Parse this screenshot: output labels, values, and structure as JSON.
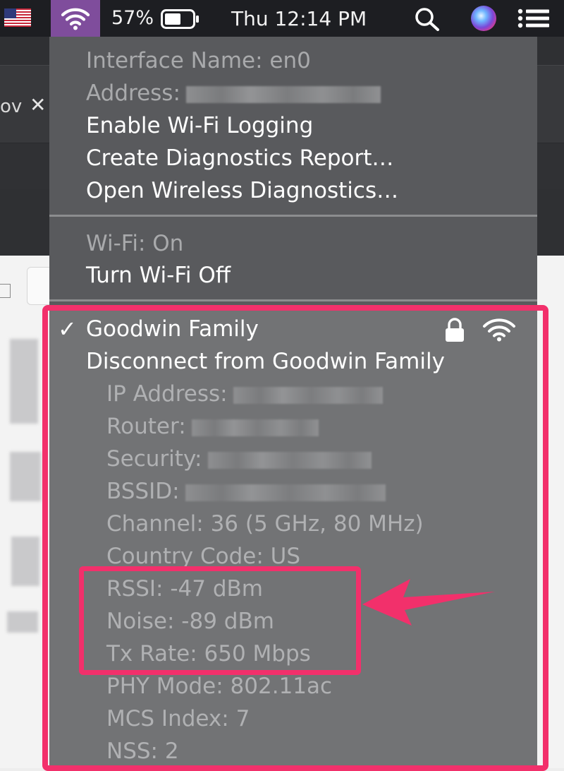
{
  "menubar": {
    "battery_percent": "57%",
    "clock": "Thu 12:14 PM"
  },
  "background": {
    "tab_text": "ov",
    "tab_close": "✕"
  },
  "menu": {
    "interface_name": "Interface Name: en0",
    "address_label": "Address:",
    "enable_logging": "Enable Wi-Fi Logging",
    "create_report": "Create Diagnostics Report…",
    "open_diagnostics": "Open Wireless Diagnostics…",
    "wifi_status": "Wi-Fi: On",
    "turn_off": "Turn Wi-Fi Off",
    "checkmark": "✓",
    "network_name": "Goodwin Family",
    "disconnect": "Disconnect from Goodwin Family",
    "details": {
      "ip_address": "IP Address:",
      "router": "Router:",
      "security": "Security:",
      "bssid": "BSSID:",
      "channel": "Channel: 36 (5 GHz, 80 MHz)",
      "country_code": "Country Code: US",
      "rssi": "RSSI: -47 dBm",
      "noise": "Noise: -89 dBm",
      "tx_rate": "Tx Rate: 650 Mbps",
      "phy_mode": "PHY Mode: 802.11ac",
      "mcs_index": "MCS Index: 7",
      "nss": "NSS: 2"
    }
  },
  "colors": {
    "accent_highlight": "#f2306b",
    "wifi_menu_active": "#7f4d9c",
    "menubar": "#1d1e22"
  },
  "icons": [
    "us-flag-icon",
    "wifi-icon",
    "battery-icon",
    "search-icon",
    "siri-icon",
    "notification-list-icon",
    "lock-icon",
    "wifi-signal-icon",
    "arrow-annotation"
  ]
}
